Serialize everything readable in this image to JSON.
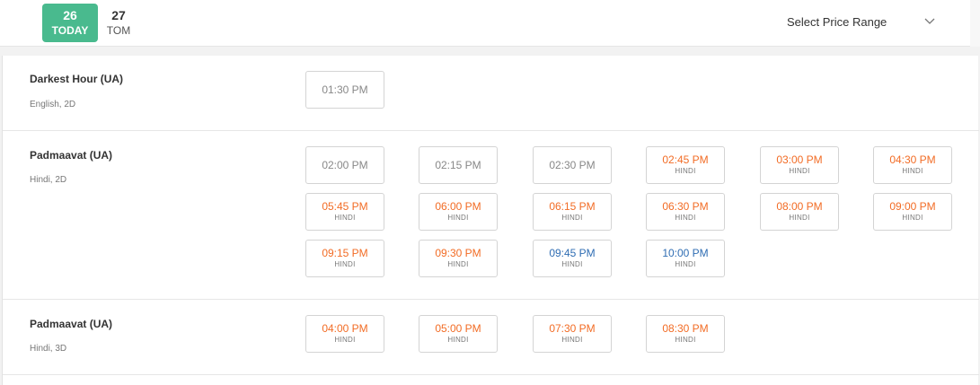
{
  "dates": [
    {
      "num": "26",
      "label": "TODAY",
      "active": true
    },
    {
      "num": "27",
      "label": "TOM",
      "active": false
    }
  ],
  "price_range": {
    "label": "Select Price Range",
    "icon": "chevron-down-icon"
  },
  "colors": {
    "accent": "#49ba8e",
    "available": "#f26c25",
    "fast_filling": "#2f6db3",
    "unavailable": "#888888"
  },
  "movies": [
    {
      "title": "Darkest Hour (UA)",
      "meta": "English, 2D",
      "showtimes": [
        {
          "time": "01:30 PM",
          "tag": "",
          "status": "plain"
        }
      ]
    },
    {
      "title": "Padmaavat (UA)",
      "meta": "Hindi, 2D",
      "showtimes": [
        {
          "time": "02:00 PM",
          "tag": "",
          "status": "plain"
        },
        {
          "time": "02:15 PM",
          "tag": "",
          "status": "plain"
        },
        {
          "time": "02:30 PM",
          "tag": "",
          "status": "plain"
        },
        {
          "time": "02:45 PM",
          "tag": "HINDI",
          "status": "orange"
        },
        {
          "time": "03:00 PM",
          "tag": "HINDI",
          "status": "orange"
        },
        {
          "time": "04:30 PM",
          "tag": "HINDI",
          "status": "orange"
        },
        {
          "time": "05:45 PM",
          "tag": "HINDI",
          "status": "orange"
        },
        {
          "time": "06:00 PM",
          "tag": "HINDI",
          "status": "orange"
        },
        {
          "time": "06:15 PM",
          "tag": "HINDI",
          "status": "orange"
        },
        {
          "time": "06:30 PM",
          "tag": "HINDI",
          "status": "orange"
        },
        {
          "time": "08:00 PM",
          "tag": "HINDI",
          "status": "orange"
        },
        {
          "time": "09:00 PM",
          "tag": "HINDI",
          "status": "orange"
        },
        {
          "time": "09:15 PM",
          "tag": "HINDI",
          "status": "orange"
        },
        {
          "time": "09:30 PM",
          "tag": "HINDI",
          "status": "orange"
        },
        {
          "time": "09:45 PM",
          "tag": "HINDI",
          "status": "blue"
        },
        {
          "time": "10:00 PM",
          "tag": "HINDI",
          "status": "blue"
        }
      ]
    },
    {
      "title": "Padmaavat (UA)",
      "meta": "Hindi, 3D",
      "showtimes": [
        {
          "time": "04:00 PM",
          "tag": "HINDI",
          "status": "orange"
        },
        {
          "time": "05:00 PM",
          "tag": "HINDI",
          "status": "orange"
        },
        {
          "time": "07:30 PM",
          "tag": "HINDI",
          "status": "orange"
        },
        {
          "time": "08:30 PM",
          "tag": "HINDI",
          "status": "orange"
        }
      ]
    }
  ]
}
